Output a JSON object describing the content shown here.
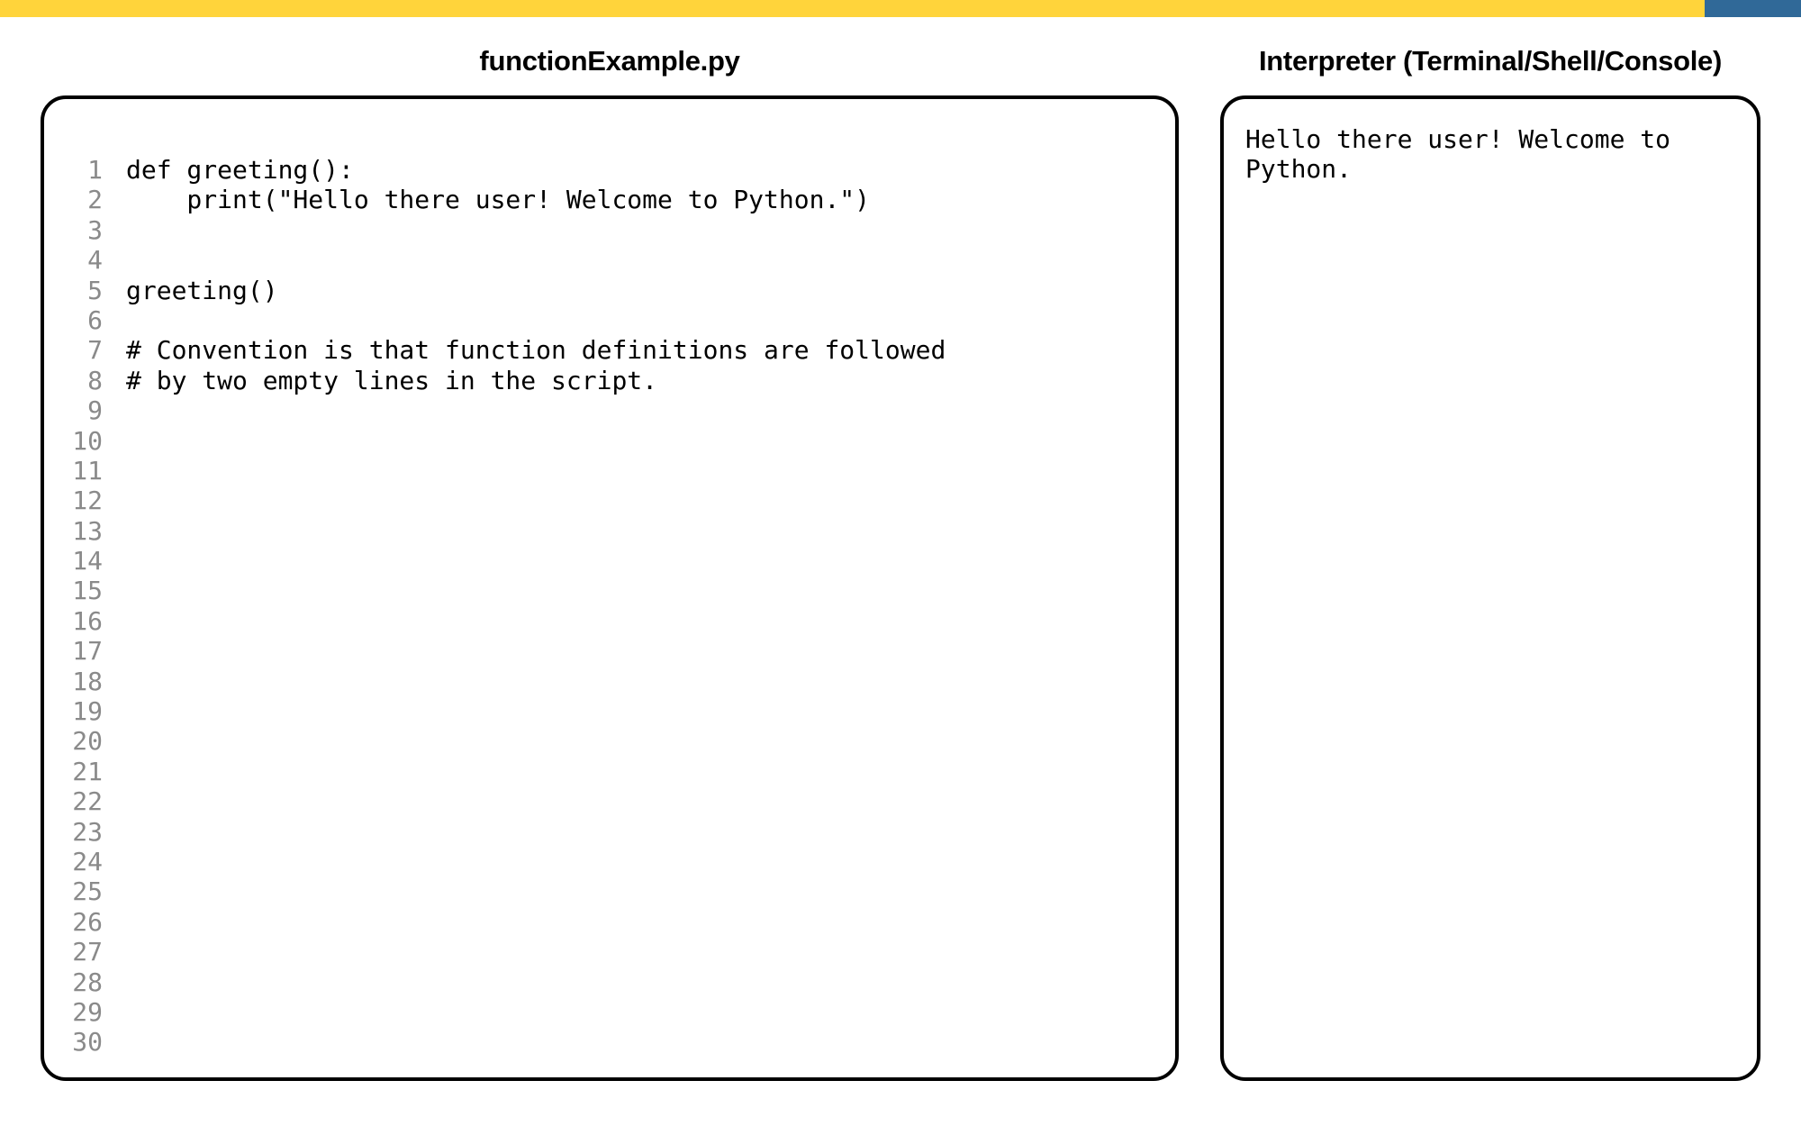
{
  "editor": {
    "title": "functionExample.py",
    "line_numbers": [
      "1",
      "2",
      "3",
      "4",
      "5",
      "6",
      "7",
      "8",
      "9",
      "10",
      "11",
      "12",
      "13",
      "14",
      "15",
      "16",
      "17",
      "18",
      "19",
      "20",
      "21",
      "22",
      "23",
      "24",
      "25",
      "26",
      "27",
      "28",
      "29",
      "30"
    ],
    "code_lines": [
      "def greeting():",
      "    print(\"Hello there user! Welcome to Python.\")",
      "",
      "",
      "greeting()",
      "",
      "# Convention is that function definitions are followed",
      "# by two empty lines in the script."
    ]
  },
  "interpreter": {
    "title": "Interpreter (Terminal/Shell/Console)",
    "output_lines": [
      "Hello there user! Welcome to",
      "Python."
    ]
  },
  "colors": {
    "top_bar": "#FFD43B",
    "top_accent": "#306998",
    "line_number": "#8a8a8a",
    "text": "#000000"
  }
}
